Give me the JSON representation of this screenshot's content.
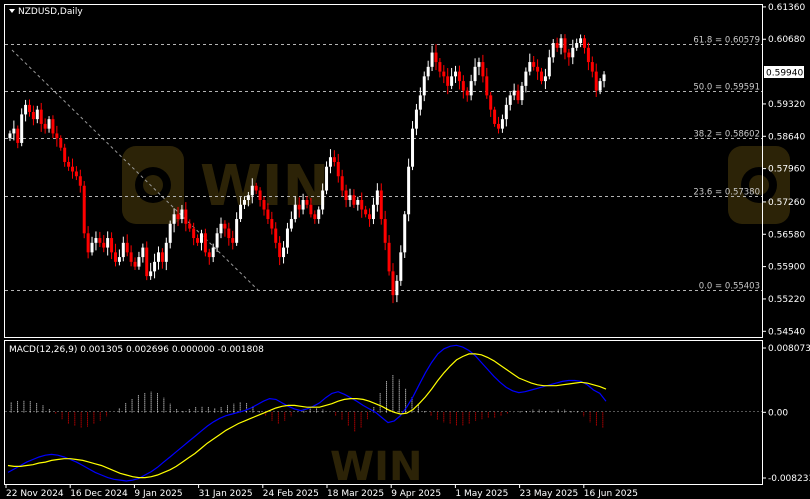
{
  "symbol_label": "NZDUSD,Daily",
  "colors": {
    "background": "#000000",
    "frame": "#ffffff",
    "bull_candle": "#ffffff",
    "bear_candle": "#ff0000",
    "macd_line": "#0000ff",
    "signal_line": "#ffff00",
    "hist_positive": "#ffffff",
    "hist_negative": "#ff0000",
    "fib_line": "#b4b4b4",
    "watermark": "#c8a020"
  },
  "chart_data": [
    {
      "type": "candlestick",
      "title": "NZDUSD,Daily",
      "y_ticks": [
        0.6136,
        0.6068,
        0.5932,
        0.5864,
        0.5796,
        0.5726,
        0.5658,
        0.559,
        0.5522,
        0.5454
      ],
      "y_tick_labels": [
        "0.61360",
        "0.60680",
        "0.59320",
        "0.58640",
        "0.57960",
        "0.57260",
        "0.56580",
        "0.55900",
        "0.55220",
        "0.54540"
      ],
      "ylim": [
        0.5442,
        0.614
      ],
      "current_price_label": "0.59940",
      "current_price": 0.5994,
      "x_tick_labels": [
        "22 Nov 2024",
        "16 Dec 2024",
        "9 Jan 2025",
        "31 Jan 2025",
        "24 Feb 2025",
        "18 Mar 2025",
        "9 Apr 2025",
        "1 May 2025",
        "23 May 2025",
        "16 Jun 2025"
      ],
      "fibonacci_levels": [
        {
          "label": "61.8 = 0.60579",
          "value": 0.60579
        },
        {
          "label": "50.0 = 0.59591",
          "value": 0.59591
        },
        {
          "label": "38.2 = 0.58602",
          "value": 0.58602
        },
        {
          "label": "23.6 = 0.57380",
          "value": 0.5738
        },
        {
          "label": "0.0 = 0.55403",
          "value": 0.55403
        }
      ],
      "series": [
        {
          "name": "close",
          "values": [
            0.587,
            0.588,
            0.585,
            0.591,
            0.593,
            0.5915,
            0.59,
            0.592,
            0.589,
            0.588,
            0.59,
            0.587,
            0.586,
            0.584,
            0.581,
            0.58,
            0.579,
            0.578,
            0.576,
            0.566,
            0.562,
            0.564,
            0.565,
            0.564,
            0.563,
            0.565,
            0.562,
            0.56,
            0.561,
            0.564,
            0.562,
            0.56,
            0.559,
            0.561,
            0.563,
            0.557,
            0.558,
            0.56,
            0.562,
            0.56,
            0.564,
            0.568,
            0.57,
            0.569,
            0.571,
            0.568,
            0.567,
            0.565,
            0.564,
            0.566,
            0.562,
            0.561,
            0.563,
            0.566,
            0.568,
            0.567,
            0.565,
            0.564,
            0.569,
            0.572,
            0.573,
            0.574,
            0.576,
            0.575,
            0.573,
            0.571,
            0.569,
            0.567,
            0.564,
            0.561,
            0.563,
            0.567,
            0.569,
            0.572,
            0.571,
            0.573,
            0.572,
            0.57,
            0.569,
            0.571,
            0.575,
            0.58,
            0.582,
            0.581,
            0.578,
            0.575,
            0.573,
            0.574,
            0.572,
            0.573,
            0.571,
            0.57,
            0.569,
            0.572,
            0.575,
            0.569,
            0.564,
            0.558,
            0.553,
            0.556,
            0.562,
            0.57,
            0.58,
            0.588,
            0.592,
            0.595,
            0.599,
            0.601,
            0.604,
            0.602,
            0.6,
            0.599,
            0.597,
            0.599,
            0.6,
            0.598,
            0.596,
            0.595,
            0.598,
            0.601,
            0.602,
            0.599,
            0.595,
            0.592,
            0.589,
            0.588,
            0.59,
            0.593,
            0.595,
            0.596,
            0.594,
            0.597,
            0.6,
            0.602,
            0.601,
            0.6,
            0.598,
            0.599,
            0.603,
            0.606,
            0.605,
            0.607,
            0.604,
            0.603,
            0.605,
            0.606,
            0.607,
            0.605,
            0.602,
            0.6,
            0.596,
            0.598,
            0.5994
          ]
        }
      ]
    },
    {
      "type": "line",
      "title": "MACD(12,26,9) 0.001305 0.002696 0.000000 -0.001808",
      "y_tick_labels": [
        "0.008073",
        "0.00",
        "-0.008233"
      ],
      "ylim": [
        -0.008233,
        0.008073
      ],
      "series": [
        {
          "name": "MACD",
          "values": [
            -0.007,
            -0.0066,
            -0.0062,
            -0.0058,
            -0.0055,
            -0.0052,
            -0.005,
            -0.0049,
            -0.005,
            -0.0052,
            -0.0055,
            -0.0058,
            -0.0062,
            -0.0066,
            -0.007,
            -0.0073,
            -0.0076,
            -0.0078,
            -0.0079,
            -0.008,
            -0.0079,
            -0.0077,
            -0.0073,
            -0.0069,
            -0.0064,
            -0.0058,
            -0.0052,
            -0.0046,
            -0.004,
            -0.0034,
            -0.0028,
            -0.0022,
            -0.0016,
            -0.0011,
            -0.0007,
            -0.0004,
            -0.0002,
            0.0,
            0.0002,
            0.0005,
            0.0009,
            0.0013,
            0.0016,
            0.0015,
            0.0011,
            0.0007,
            0.0004,
            0.0002,
            0.0004,
            0.0007,
            0.0011,
            0.0017,
            0.0022,
            0.0024,
            0.0021,
            0.0017,
            0.0013,
            0.0008,
            0.0004,
            0.0,
            -0.0006,
            -0.0012,
            -0.001,
            -0.0004,
            0.0006,
            0.0018,
            0.0032,
            0.0046,
            0.0058,
            0.0068,
            0.0074,
            0.0077,
            0.0078,
            0.0076,
            0.0072,
            0.0066,
            0.0058,
            0.005,
            0.0042,
            0.0035,
            0.0029,
            0.0025,
            0.0023,
            0.0024,
            0.0026,
            0.0028,
            0.003,
            0.0032,
            0.0034,
            0.0036,
            0.0037,
            0.0037,
            0.0036,
            0.0032,
            0.0026,
            0.0022,
            0.0013
          ]
        },
        {
          "name": "Signal",
          "values": [
            -0.0062,
            -0.0063,
            -0.0063,
            -0.0062,
            -0.0061,
            -0.0059,
            -0.0058,
            -0.0056,
            -0.0055,
            -0.0054,
            -0.0054,
            -0.0055,
            -0.0056,
            -0.0058,
            -0.006,
            -0.0062,
            -0.0065,
            -0.0068,
            -0.0071,
            -0.0073,
            -0.0075,
            -0.0076,
            -0.0076,
            -0.0075,
            -0.0073,
            -0.007,
            -0.0067,
            -0.0063,
            -0.0058,
            -0.0053,
            -0.0048,
            -0.0042,
            -0.0036,
            -0.0031,
            -0.0026,
            -0.0021,
            -0.0017,
            -0.0013,
            -0.001,
            -0.0007,
            -0.0004,
            -0.0001,
            0.0002,
            0.0005,
            0.0007,
            0.0008,
            0.0008,
            0.0007,
            0.0006,
            0.0006,
            0.0006,
            0.0008,
            0.001,
            0.0013,
            0.0015,
            0.0016,
            0.0016,
            0.0015,
            0.0013,
            0.001,
            0.0007,
            0.0003,
            -0.0,
            -0.0002,
            -0.0001,
            0.0003,
            0.001,
            0.0018,
            0.0027,
            0.0037,
            0.0046,
            0.0054,
            0.0061,
            0.0065,
            0.0068,
            0.0068,
            0.0067,
            0.0064,
            0.006,
            0.0055,
            0.005,
            0.0045,
            0.004,
            0.0037,
            0.0034,
            0.0032,
            0.0031,
            0.0031,
            0.0031,
            0.0032,
            0.0033,
            0.0034,
            0.0035,
            0.0034,
            0.0032,
            0.003,
            0.0027
          ]
        },
        {
          "name": "Histogram",
          "values": [
            0.0012,
            0.0013,
            0.0014,
            0.0013,
            0.0011,
            0.0008,
            0.0004,
            -0.0002,
            -0.0008,
            -0.0013,
            -0.0016,
            -0.0018,
            -0.0017,
            -0.0014,
            -0.001,
            -0.0005,
            0.0,
            0.0005,
            0.0011,
            0.0016,
            0.002,
            0.0023,
            0.0024,
            0.0022,
            0.0017,
            0.001,
            0.0004,
            0.0002,
            0.0004,
            0.0006,
            0.0007,
            0.0006,
            0.0005,
            0.0006,
            0.0008,
            0.001,
            0.0012,
            0.0011,
            0.0007,
            0.0002,
            -0.0004,
            -0.001,
            -0.0013,
            -0.001,
            -0.0005,
            0.0,
            0.0004,
            0.0006,
            0.0005,
            0.0003,
            0.0,
            -0.0004,
            -0.0009,
            -0.0016,
            -0.0022,
            -0.0018,
            -0.0008,
            0.0006,
            0.0022,
            0.0036,
            0.0043,
            0.0038,
            0.0028,
            0.0018,
            0.001,
            0.0002,
            -0.0004,
            -0.0009,
            -0.0012,
            -0.0014,
            -0.0015,
            -0.0015,
            -0.0013,
            -0.001,
            -0.0008,
            -0.0007,
            -0.0006,
            -0.0004,
            -0.0002,
            0.0,
            0.0001,
            0.0002,
            0.0003,
            0.0003,
            0.0002,
            0.0002,
            0.0003,
            0.0003,
            0.0002,
            0.0001,
            -0.0005,
            -0.0012,
            -0.0016,
            -0.0018
          ]
        }
      ]
    }
  ]
}
